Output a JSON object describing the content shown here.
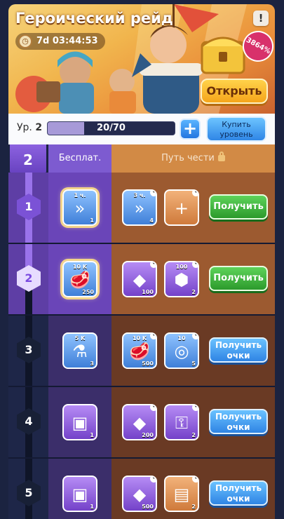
{
  "event": {
    "title": "Героический рейд",
    "timer": "7d 03:44:53",
    "alert_symbol": "!",
    "discount_badge": "3864%",
    "open_button": "Открыть"
  },
  "level": {
    "label": "Ур.",
    "value": "2",
    "progress_text": "20/70",
    "progress_fraction": 0.2857,
    "plus_symbol": "+",
    "buy_level_line1": "Купить",
    "buy_level_line2": "уровень"
  },
  "columns": {
    "current_level": "2",
    "free": "Бесплат.",
    "honor": "Путь чести"
  },
  "rows": [
    {
      "level": "1",
      "free": {
        "icon": "speedup-icon",
        "top": "1 ч.",
        "bottom": "1"
      },
      "honor": [
        {
          "icon": "speedup-icon",
          "top": "3 ч.",
          "bottom": "4"
        },
        {
          "icon": "plus-chest-icon",
          "top": "",
          "bottom": ""
        }
      ],
      "action_line1": "Получить",
      "action_line2": ""
    },
    {
      "level": "2",
      "free": {
        "icon": "meat-icon",
        "top": "10 K",
        "bottom": "250"
      },
      "honor": [
        {
          "icon": "gems-icon",
          "top": "",
          "bottom": "100"
        },
        {
          "icon": "gear-token-icon",
          "top": "100",
          "bottom": "2"
        }
      ],
      "action_line1": "Получить",
      "action_line2": ""
    },
    {
      "level": "3",
      "free": {
        "icon": "xp-potion-icon",
        "top": "5 K",
        "bottom": "3"
      },
      "honor": [
        {
          "icon": "meat-icon",
          "top": "10 K",
          "bottom": "500"
        },
        {
          "icon": "rope-icon",
          "top": "10",
          "bottom": "5"
        }
      ],
      "action_line1": "Получить",
      "action_line2": "очки"
    },
    {
      "level": "4",
      "free": {
        "icon": "book-icon",
        "top": "",
        "bottom": "1"
      },
      "honor": [
        {
          "icon": "gems-icon",
          "top": "",
          "bottom": "200"
        },
        {
          "icon": "key-icon",
          "top": "",
          "bottom": "2"
        }
      ],
      "action_line1": "Получить",
      "action_line2": "очки"
    },
    {
      "level": "5",
      "free": {
        "icon": "book-icon",
        "top": "",
        "bottom": "1"
      },
      "honor": [
        {
          "icon": "gems-icon",
          "top": "",
          "bottom": "500"
        },
        {
          "icon": "scroll-book-icon",
          "top": "",
          "bottom": "2"
        }
      ],
      "action_line1": "Получить",
      "action_line2": "очки"
    }
  ]
}
